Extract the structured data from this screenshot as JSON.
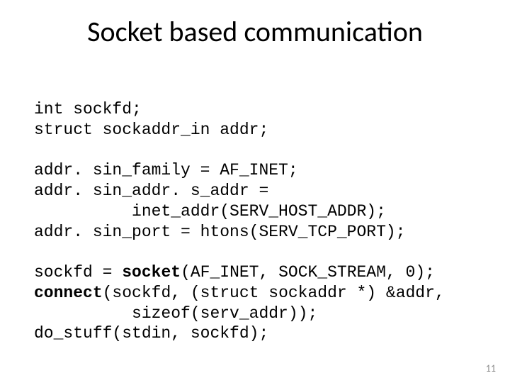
{
  "title": "Socket based communication",
  "code": {
    "l1": "int sockfd;",
    "l2": "struct sockaddr_in addr;",
    "l3": "",
    "l4": "addr. sin_family = AF_INET;",
    "l5": "addr. sin_addr. s_addr =",
    "l6": "          inet_addr(SERV_HOST_ADDR);",
    "l7": "addr. sin_port = htons(SERV_TCP_PORT);",
    "l8": "",
    "l9a": "sockfd = ",
    "l9b": "socket",
    "l9c": "(AF_INET, SOCK_STREAM, 0);",
    "l10a": "connect",
    "l10b": "(sockfd, (struct sockaddr *) &addr,",
    "l11": "          sizeof(serv_addr));",
    "l12": "do_stuff(stdin, sockfd);"
  },
  "page_number": "11"
}
